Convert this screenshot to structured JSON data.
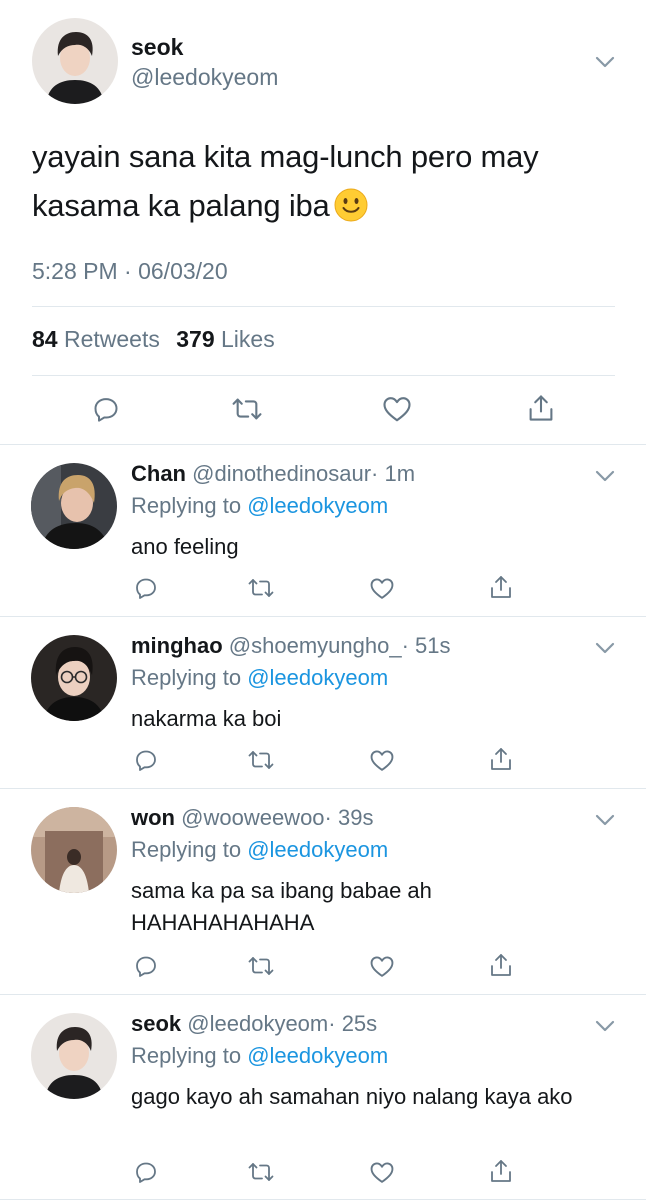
{
  "main_tweet": {
    "name": "seok",
    "handle": "@leedokyeom",
    "text": "yayain sana kita mag-lunch pero may kasama ka palang iba",
    "timestamp": "5:28 PM · 06/03/20",
    "retweets": "84",
    "retweets_label": "Retweets",
    "likes": "379",
    "likes_label": "Likes"
  },
  "replying_to_label": "Replying to",
  "replies": [
    {
      "name": "Chan",
      "handle": "@dinothedinosaur",
      "time": "· 1m",
      "replying_to": "@leedokyeom",
      "text": "ano feeling"
    },
    {
      "name": "minghao",
      "handle": "@shoemyungho_",
      "time": "· 51s",
      "replying_to": "@leedokyeom",
      "text": "nakarma ka boi"
    },
    {
      "name": "won",
      "handle": "@wooweewoo",
      "time": "· 39s",
      "replying_to": "@leedokyeom",
      "text": "sama ka pa sa ibang babae ah HAHAHAHAHAHA"
    },
    {
      "name": "seok",
      "handle": "@leedokyeom",
      "time": "· 25s",
      "replying_to": "@leedokyeom",
      "text": "gago kayo ah samahan niyo nalang kaya ako"
    }
  ],
  "icons": {
    "reply": "reply-icon",
    "retweet": "retweet-icon",
    "like": "heart-icon",
    "share": "share-icon",
    "more": "chevron-down-icon",
    "emoji": "slightly-smiling-face-emoji"
  },
  "colors": {
    "text": "#14171a",
    "secondary": "#657786",
    "link": "#1b95e0",
    "divider": "#e1e8ed"
  }
}
